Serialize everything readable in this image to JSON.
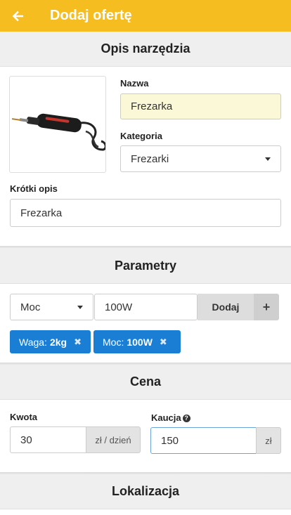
{
  "header": {
    "title": "Dodaj ofertę",
    "back_icon": "arrow-left-icon",
    "background": "#f5bd1f"
  },
  "description_section": {
    "title": "Opis narzędzia",
    "name_label": "Nazwa",
    "name_value": "Frezarka",
    "category_label": "Kategoria",
    "category_value": "Frezarki",
    "short_desc_label": "Krótki opis",
    "short_desc_value": "Frezarka"
  },
  "parameters_section": {
    "title": "Parametry",
    "param_select": "Moc",
    "param_value": "100W",
    "add_label": "Dodaj",
    "plus_label": "+",
    "tags": [
      {
        "key": "Waga:",
        "value": "2kg",
        "remove": "✖"
      },
      {
        "key": "Moc:",
        "value": "100W",
        "remove": "✖"
      }
    ],
    "tag_color": "#1a7fd4"
  },
  "price_section": {
    "title": "Cena",
    "amount_label": "Kwota",
    "amount_value": "30",
    "amount_unit": "zł / dzień",
    "deposit_label": "Kaucja",
    "deposit_help": "?",
    "deposit_value": "150",
    "deposit_unit": "zł"
  },
  "location_section": {
    "title": "Lokalizacja"
  }
}
